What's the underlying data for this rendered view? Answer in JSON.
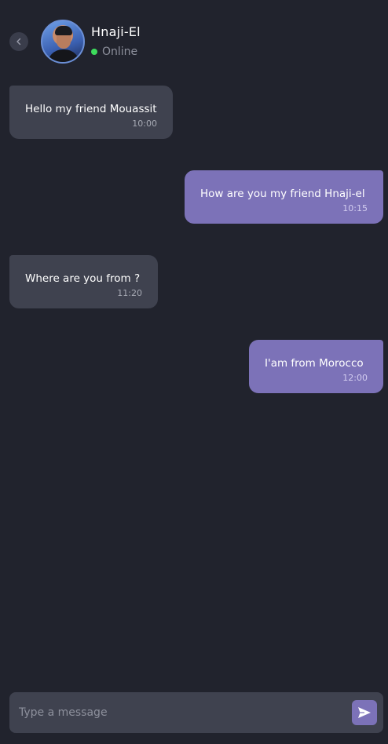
{
  "header": {
    "contact_name": "Hnaji-El",
    "status": "Online"
  },
  "messages": [
    {
      "direction": "in",
      "text": "Hello my friend Mouassit",
      "time": "10:00"
    },
    {
      "direction": "out",
      "text": "How are you my friend Hnaji-el",
      "time": "10:15"
    },
    {
      "direction": "in",
      "text": "Where are you from ?",
      "time": "11:20"
    },
    {
      "direction": "out",
      "text": "I'am from Morocco",
      "time": "12:00"
    }
  ],
  "composer": {
    "placeholder": "Type a message",
    "value": ""
  },
  "icons": {
    "back": "chevron-left-icon",
    "send": "send-icon"
  },
  "colors": {
    "background": "#21232d",
    "incoming_bubble": "#3f424f",
    "outgoing_bubble": "#7c72b8",
    "online": "#3ddc5c"
  }
}
